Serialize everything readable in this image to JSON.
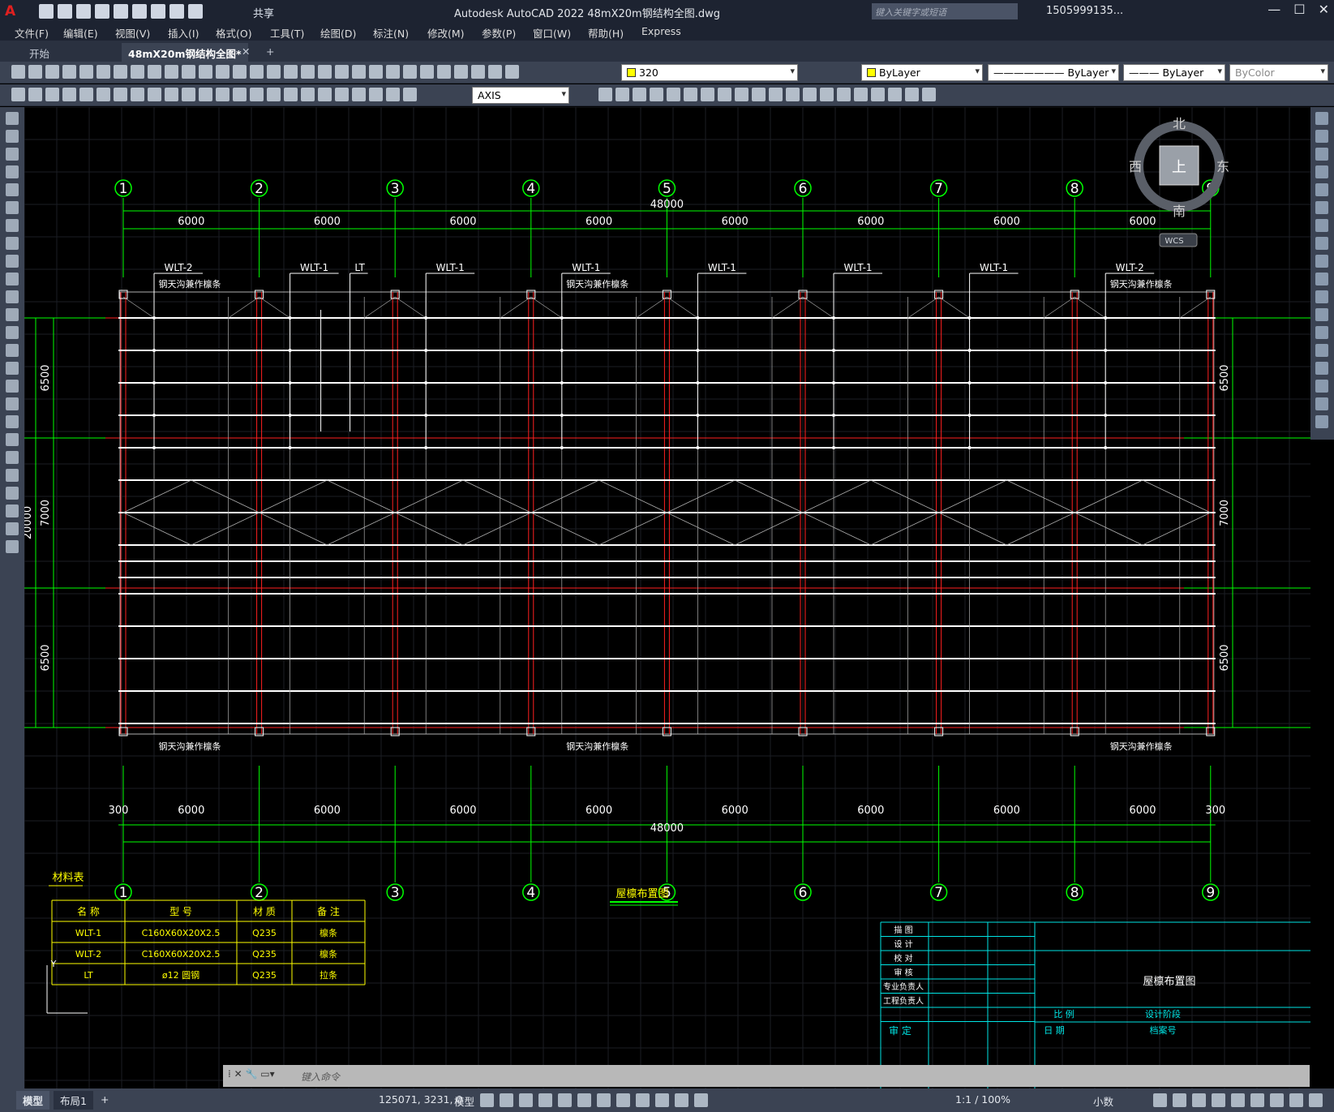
{
  "app": {
    "title": "Autodesk AutoCAD 2022    48mX20m钢结构全图.dwg",
    "share": "共享",
    "search_placeholder": "键入关键字或短语",
    "user": "1505999135...",
    "logo": "A"
  },
  "menu": [
    "文件(F)",
    "编辑(E)",
    "视图(V)",
    "插入(I)",
    "格式(O)",
    "工具(T)",
    "绘图(D)",
    "标注(N)",
    "修改(M)",
    "参数(P)",
    "窗口(W)",
    "帮助(H)",
    "Express"
  ],
  "tabs": [
    "开始",
    "48mX20m钢结构全图*"
  ],
  "toolbar": {
    "layer_value": "320",
    "color_value": "ByLayer",
    "linetype_value": "ByLayer",
    "lineweight_value": "ByLayer",
    "plotstyle_value": "ByColor",
    "dimstyle_value": "AXIS"
  },
  "viewcube": {
    "north": "北",
    "south": "南",
    "east": "东",
    "west": "西",
    "top": "上",
    "wcs": "WCS"
  },
  "drawing": {
    "axes": [
      "1",
      "2",
      "3",
      "4",
      "5",
      "6",
      "7",
      "8",
      "9"
    ],
    "bay_dim": "6000",
    "total_dim": "48000",
    "edge_dim": "300",
    "side_dims": [
      "6500",
      "7000",
      "6500"
    ],
    "width_dim": "20000",
    "labels_top": [
      "WLT-2",
      "WLT-1",
      "WLT-1",
      "WLT-1",
      "WLT-1",
      "WLT-1",
      "WLT-1",
      "WLT-2"
    ],
    "lt_label": "LT",
    "gutter_note": "钢天沟兼作檩条",
    "drawing_title": "屋檩布置图",
    "material_title": "材料表",
    "material_headers": [
      "名 称",
      "型 号",
      "材 质",
      "备 注"
    ],
    "material_rows": [
      [
        "WLT-1",
        "C160X60X20X2.5",
        "Q235",
        "檩条"
      ],
      [
        "WLT-2",
        "C160X60X20X2.5",
        "Q235",
        "檩条"
      ],
      [
        "LT",
        "ø12 圆钢",
        "Q235",
        "拉条"
      ]
    ],
    "titleblock_roles": [
      "描 图",
      "设 计",
      "校 对",
      "审 核",
      "专业负责人",
      "工程负责人"
    ],
    "titleblock_name": "屋檩布置图",
    "titleblock_bottom": [
      "审 定",
      "比 例",
      "设计阶段",
      "日 期",
      "档案号"
    ]
  },
  "command": {
    "placeholder": "键入命令"
  },
  "status": {
    "layout_tabs": [
      "模型",
      "布局1"
    ],
    "coords": "125071, 3231, 0",
    "mode": "模型",
    "scale": "1:1 / 100%",
    "units": "小数"
  }
}
